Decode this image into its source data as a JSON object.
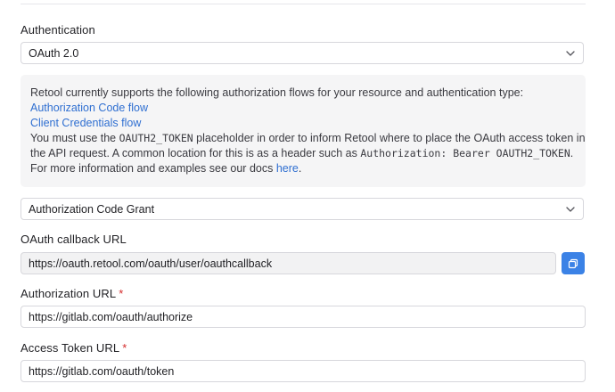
{
  "authentication": {
    "label": "Authentication",
    "selected": "OAuth 2.0"
  },
  "info": {
    "intro": "Retool currently supports the following authorization flows for your resource and authentication type:",
    "flows": [
      "Authorization Code flow",
      "Client Credentials flow"
    ],
    "line3_pre": "You must use the ",
    "token_placeholder": "OAUTH2_TOKEN",
    "line3_post": " placeholder in order to inform Retool where to place the OAuth access token in",
    "line4_pre": "the API request. A common location for this is as a header such as ",
    "header_example": "Authorization: Bearer OAUTH2_TOKEN",
    "line4_post": ".",
    "line5_pre": "For more information and examples see our docs ",
    "docs_link": "here",
    "line5_post": "."
  },
  "grant_type": {
    "selected": "Authorization Code Grant"
  },
  "callback": {
    "label": "OAuth callback URL",
    "value": "https://oauth.retool.com/oauth/user/oauthcallback"
  },
  "authorization_url": {
    "label": "Authorization URL",
    "required_mark": "*",
    "value": "https://gitlab.com/oauth/authorize"
  },
  "access_token_url": {
    "label": "Access Token URL",
    "required_mark": "*",
    "value": "https://gitlab.com/oauth/token"
  },
  "colors": {
    "link": "#2f6fd1",
    "copy_button": "#3b82e6",
    "required": "#d42a2a"
  },
  "icons": {
    "select_chevron": "chevron-down-icon",
    "copy": "copy-icon"
  }
}
